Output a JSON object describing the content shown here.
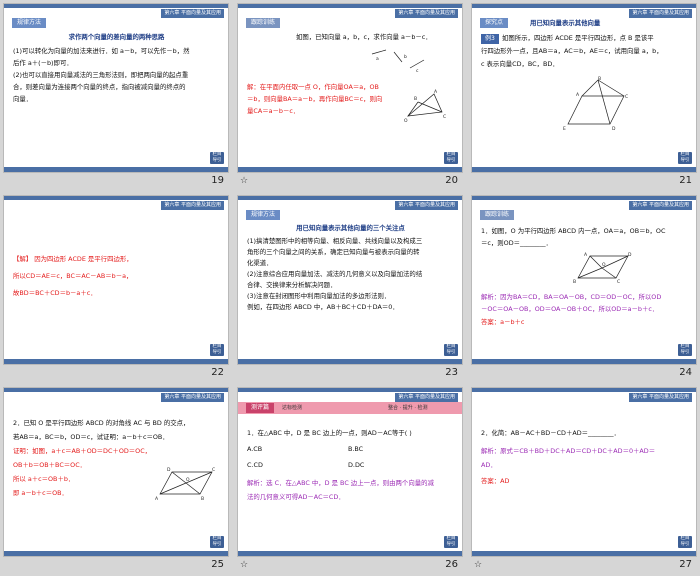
{
  "chapter": "第六章 平面向量及其应用",
  "back": "栏目\n导引",
  "star": "☆",
  "slides": [
    {
      "page": "19",
      "tag": "规律方法",
      "title": "求作两个向量的差向量的两种思路",
      "lines": [
        "(1)可以转化为向量的加法来进行．如 a－b，可以先作－b，然",
        "后作 a＋(－b)即可．",
        "(2)也可以直接用向量减法的三角形法则，即把两向量的起点重",
        "合，则差向量为连接两个向量的终点，指向被减向量的终点的",
        "向量．"
      ]
    },
    {
      "page": "20",
      "tag": "跟踪训练",
      "question": "如图，已知向量 a，b，c，求作向量 a－b－c．",
      "solution": [
        "解：在平面内任取一点 O，作向量OA＝a，OB",
        "＝b，则向量BA＝a－b，再作向量BC＝c，则向",
        "量CA＝a－b－c．"
      ]
    },
    {
      "page": "21",
      "tag": "探究点",
      "title": "用已知向量表示其他向量",
      "example_label": "例3",
      "lines": [
        "如图所示，四边形 ACDE 是平行四边形，点 B 是该平",
        "行四边形外一点，且AB＝a，AC＝b，AE＝c，试用向量 a，b，",
        "c 表示向量CD，BC，BD．"
      ]
    },
    {
      "page": "22",
      "lines": [
        "【解】  因为四边形 ACDE 是平行四边形，",
        "所以CD＝AE＝c，BC＝AC－AB＝b－a，",
        "故BD＝BC＋CD＝b－a＋c．"
      ]
    },
    {
      "page": "23",
      "tag": "规律方法",
      "title": "用已知向量表示其他向量的三个关注点",
      "lines": [
        "(1)搞清楚图形中的相等向量、相反向量、共线向量以及构成三",
        "角形的三个向量之间的关系，确定已知向量与被表示向量的转",
        "化渠道．",
        "(2)注意综合应用向量加法、减法的几何意义以及向量加法的结",
        "合律、交换律来分析解决问题．",
        "(3)注意在封闭图形中利用向量加法的多边形法则．",
        "例如，在四边形 ABCD 中，AB＋BC＋CD＋DA＝0．"
      ]
    },
    {
      "page": "24",
      "tag": "跟踪训练",
      "lines": [
        "1．如图，O 为平行四边形 ABCD 内一点，OA＝a，OB＝b，OC",
        "＝c，则OD＝________．"
      ],
      "analysis": [
        "解析：因为BA＝CD，BA＝OA－OB，CD＝OD－OC，所以OD",
        "－OC＝OA－OB，OD＝OA－OB＋OC，所以OD＝a－b＋c．"
      ],
      "answer": "答案：a－b＋c"
    },
    {
      "page": "25",
      "lines": [
        "2．已知 O 是平行四边形 ABCD 的对角线 AC 与 BD 的交点，",
        "若AB＝a，BC＝b，OD＝c，试证明：a－b＋c＝OB．"
      ],
      "proof": [
        "证明：如图，a＋c＝AB＋OD＝DC＋OD＝OC，",
        "OB＋b＝OB＋BC＝OC．",
        "所以 a＋c＝OB＋b．",
        "即 a－b＋c＝OB．"
      ]
    },
    {
      "page": "26",
      "tag": "测评篇",
      "tag_sub": "达标检测",
      "tag_right": "整合 · 提升 · 检测",
      "lines": [
        "1．在△ABC 中，D 是 BC 边上的一点，则AD－AC等于(    )"
      ],
      "options": [
        "A.CB",
        "B.BC",
        "C.CD",
        "D.DC"
      ],
      "analysis": [
        "解析：选 C．在△ABC 中，D 是 BC 边上一点，则由两个向量的减",
        "法的几何意义可得AD－AC＝CD．"
      ]
    },
    {
      "page": "27",
      "lines": [
        "2．化简：AB－AC＋BD－CD＋AD＝________．"
      ],
      "analysis": [
        "解析：原式＝CB＋BD＋DC＋AD＝CD＋DC＋AD＝0＋AD＝",
        "AD．"
      ],
      "answer": "答案：AD"
    }
  ]
}
